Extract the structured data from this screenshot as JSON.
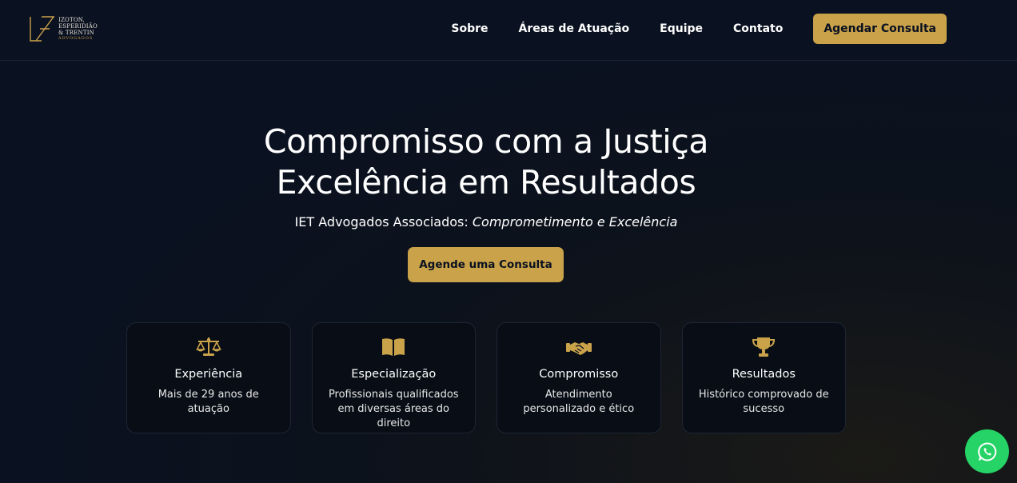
{
  "header": {
    "logo": {
      "line1": "IZOTON,",
      "line2": "ESPERIDIÃO",
      "line3": "& TRENTIN",
      "line4": "ADVOGADOS"
    },
    "nav": [
      {
        "label": "Sobre"
      },
      {
        "label": "Áreas de Atuação"
      },
      {
        "label": "Equipe"
      },
      {
        "label": "Contato"
      }
    ],
    "cta_label": "Agendar Consulta"
  },
  "hero": {
    "title_line1": "Compromisso com a Justiça",
    "title_line2": "Excelência em Resultados",
    "subtitle_plain": "IET Advogados Associados: ",
    "subtitle_italic": "Comprometimento e Excelência",
    "cta_label": "Agende uma Consulta"
  },
  "features": [
    {
      "icon": "scale-icon",
      "title": "Experiência",
      "desc": "Mais de 29 anos de atuação"
    },
    {
      "icon": "book-icon",
      "title": "Especialização",
      "desc": "Profissionais qualificados em diversas áreas do direito"
    },
    {
      "icon": "handshake-icon",
      "title": "Compromisso",
      "desc": "Atendimento personalizado e ético"
    },
    {
      "icon": "trophy-icon",
      "title": "Resultados",
      "desc": "Histórico comprovado de sucesso"
    }
  ],
  "whatsapp": {
    "icon": "whatsapp-icon"
  },
  "colors": {
    "accent": "#c9a24a",
    "background": "#0a1120",
    "whatsapp": "#25d366"
  }
}
